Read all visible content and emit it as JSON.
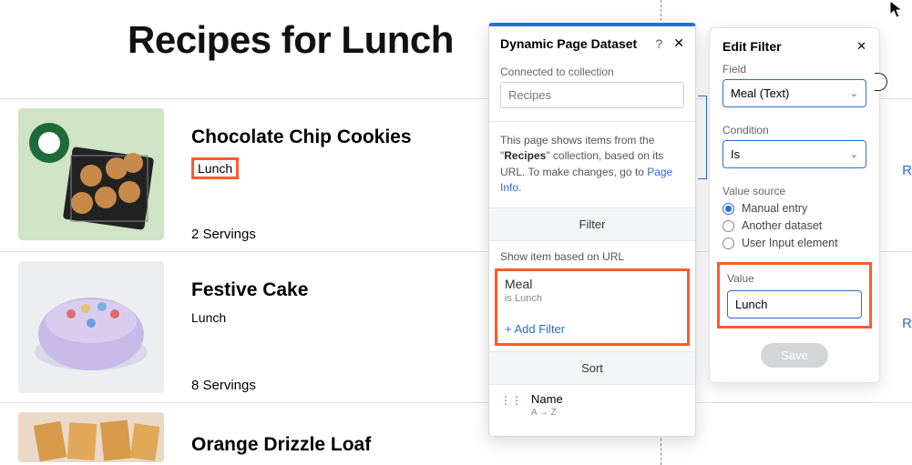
{
  "page_title": "Recipes for Lunch",
  "items": [
    {
      "title": "Chocolate Chip Cookies",
      "meal": "Lunch",
      "servings": "2 Servings",
      "read": "R"
    },
    {
      "title": "Festive Cake",
      "meal": "Lunch",
      "servings": "8 Servings",
      "read": "R"
    },
    {
      "title": "Orange Drizzle Loaf",
      "meal": "",
      "servings": "",
      "read": ""
    }
  ],
  "panel1": {
    "title": "Dynamic Page Dataset",
    "connected_label": "Connected to collection",
    "collection_value": "Recipes",
    "description_prefix": "This page shows items from the \"",
    "description_collection": "Recipes",
    "description_suffix": "\" collection, based on its URL. To make changes, go to ",
    "page_info_link": "Page Info",
    "filter_header": "Filter",
    "show_item_label": "Show item based on URL",
    "filter_field": "Meal",
    "filter_condition": "is Lunch",
    "add_filter": "+ Add Filter",
    "sort_header": "Sort",
    "sort_field": "Name",
    "sort_dir": "A → Z"
  },
  "panel2": {
    "title": "Edit Filter",
    "field_label": "Field",
    "field_value": "Meal (Text)",
    "condition_label": "Condition",
    "condition_value": "Is",
    "value_source_label": "Value source",
    "sources": [
      "Manual entry",
      "Another dataset",
      "User Input element"
    ],
    "value_label": "Value",
    "value_input": "Lunch",
    "save": "Save"
  }
}
